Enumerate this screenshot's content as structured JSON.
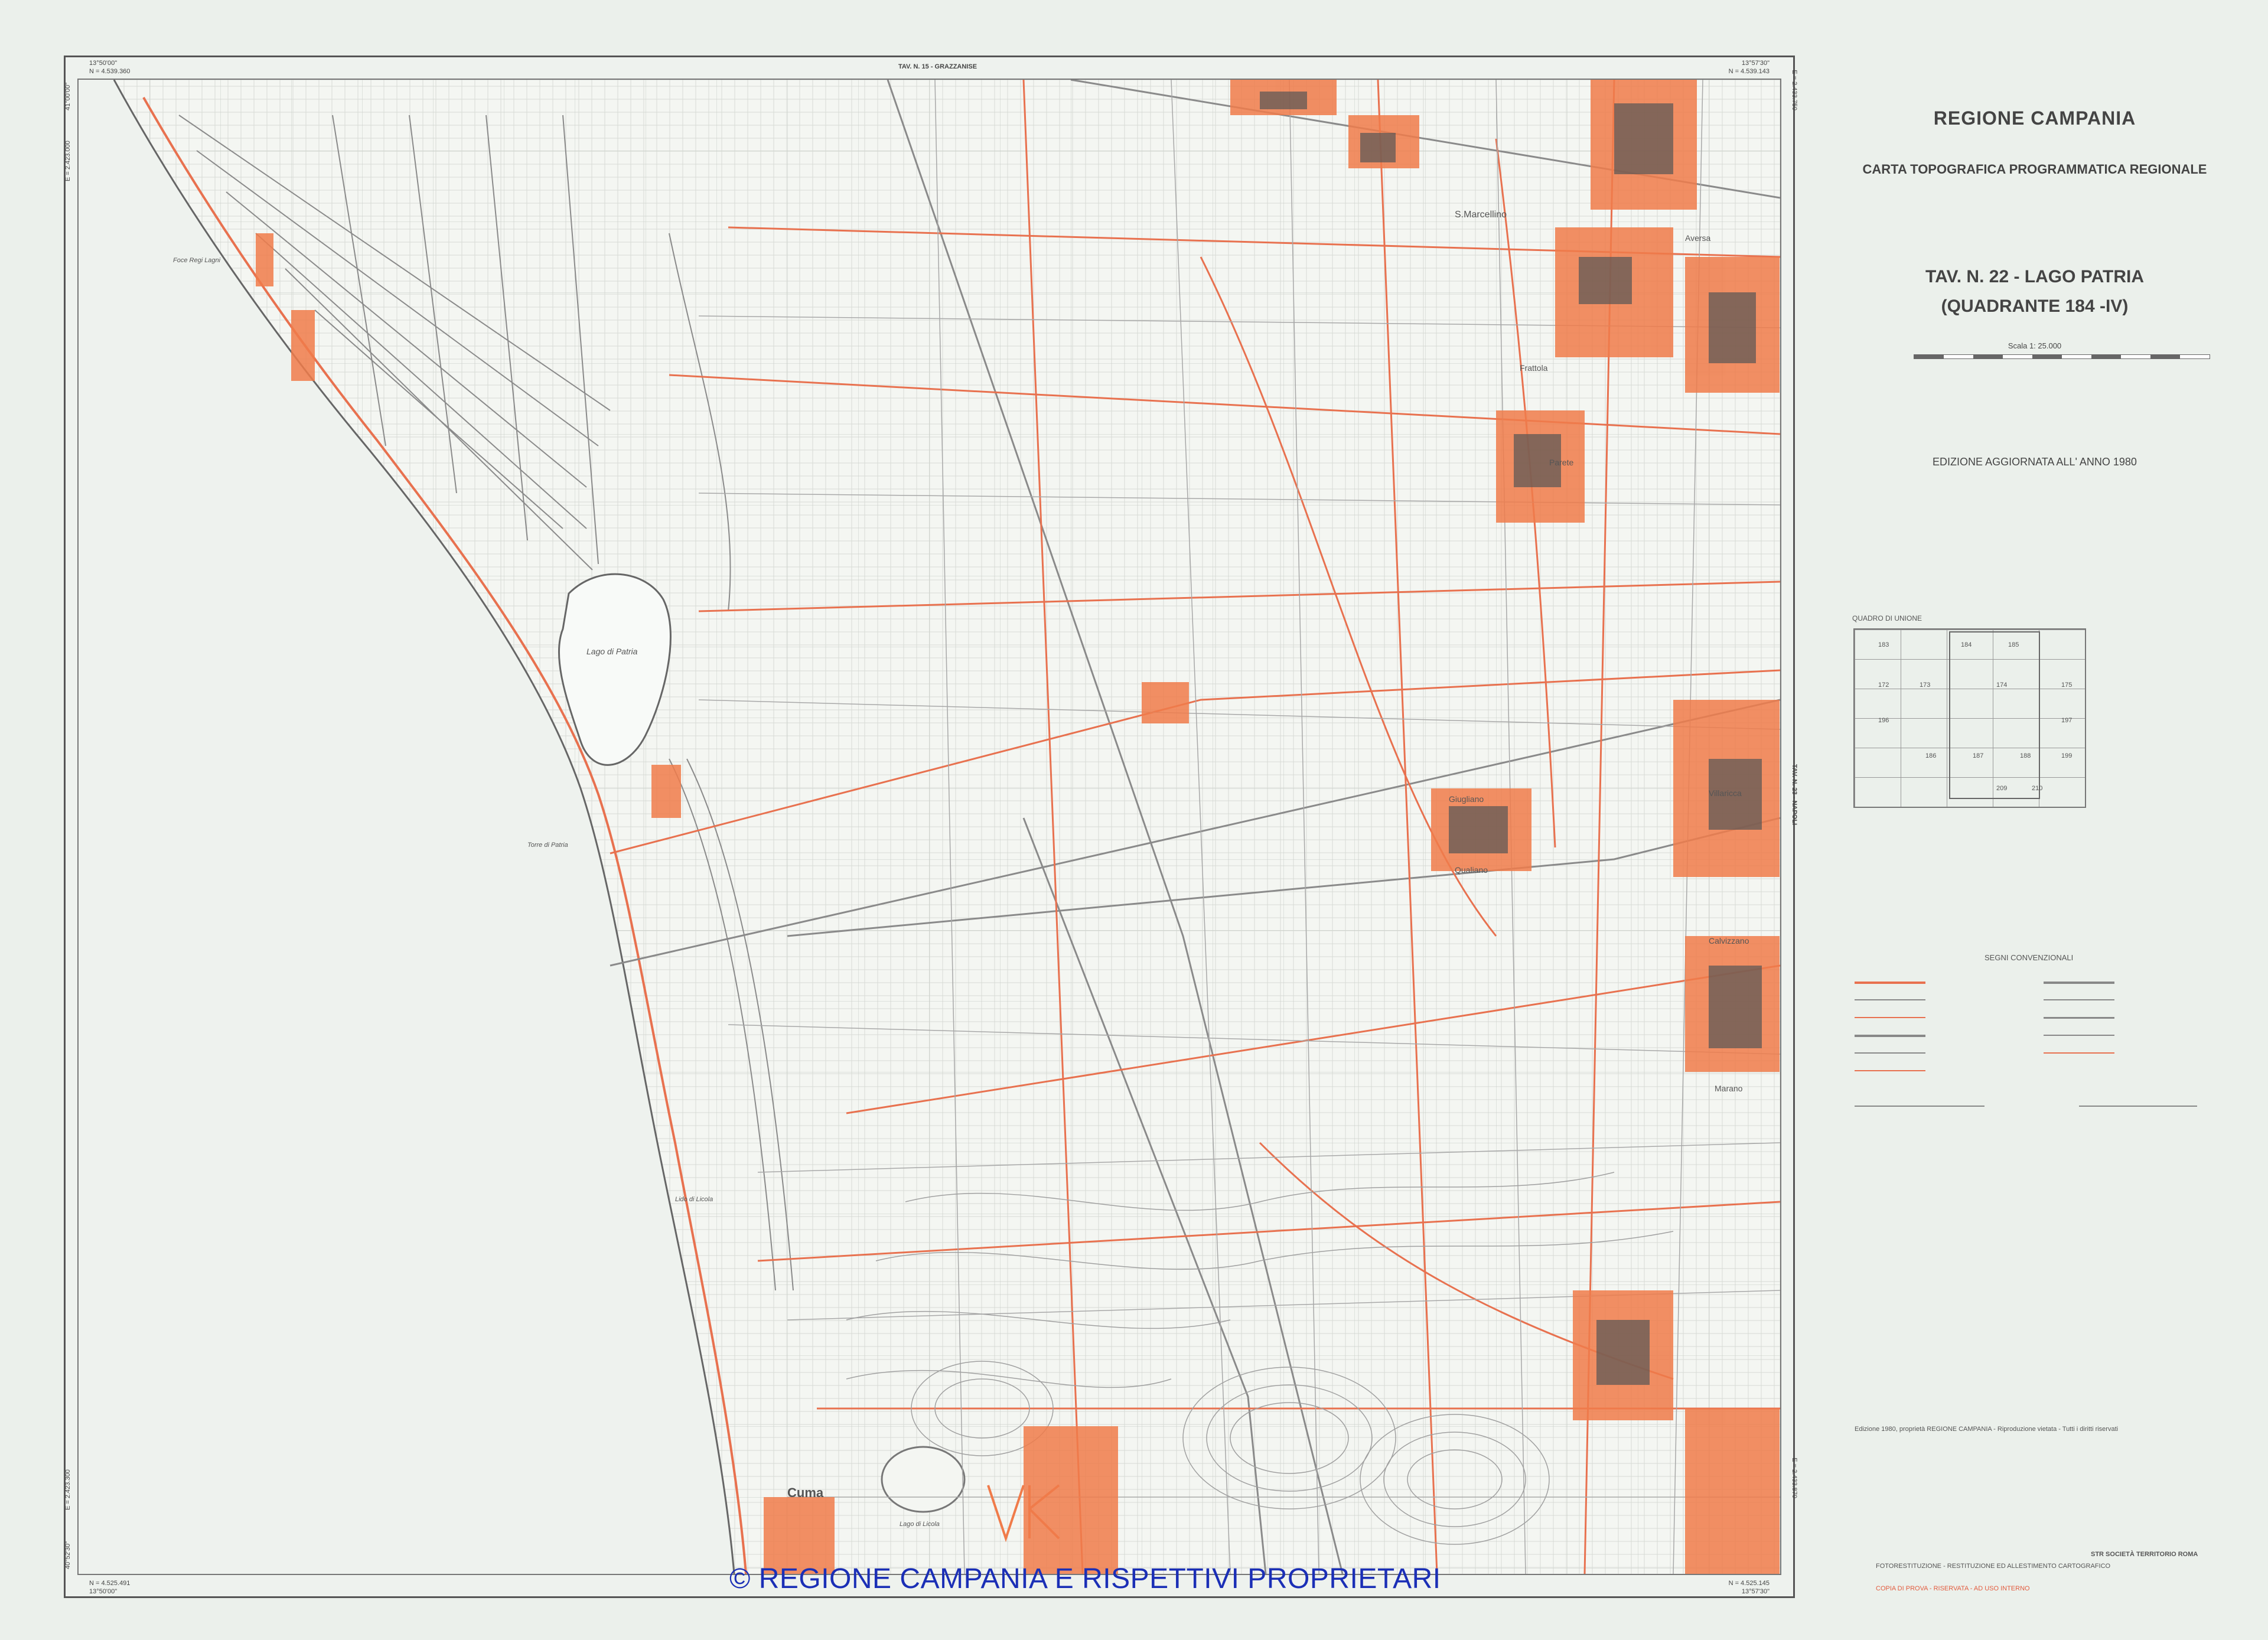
{
  "map": {
    "header_title": "TAV. N. 15 - GRAZZANISE",
    "right_side_label": "TAV. N. 23 - NAPOLI",
    "corner_coords": {
      "top_left_lon": "13°50'00\"",
      "top_left_north": "N = 4.539.360",
      "top_left_lat": "41°00'00\"",
      "top_left_east": "E = 2.423.000",
      "top_right_lon": "13°57'30\"",
      "top_right_north": "N = 4.539.143",
      "top_right_east": "E = 2.433.750",
      "bottom_left_lat": "40°52'30\"",
      "bottom_left_north": "N = 4.525.491",
      "bottom_left_lon": "13°50'00\"",
      "bottom_left_east": "E = 2.423.300",
      "bottom_right_north": "N = 4.525.145",
      "bottom_right_lon": "13°57'30\"",
      "bottom_right_east": "E = 2.433.870"
    },
    "place_labels": [
      "Lago di Patria",
      "S.Marcellino",
      "Frattola",
      "Parete",
      "Giugliano",
      "Aversa",
      "Villaricca",
      "Qualiano",
      "Calvizzano",
      "Marano",
      "Cuma",
      "Lido di Licola",
      "Foce Regi Lagni",
      "Torre di Patria",
      "Lago di Licola"
    ],
    "colors": {
      "roads": "#e8714f",
      "urban": "#f07b4a",
      "contours": "#9a9a9a",
      "grid": "#b5b5b5"
    }
  },
  "panel": {
    "title_region": "REGIONE CAMPANIA",
    "title_series": "CARTA TOPOGRAFICA PROGRAMMATICA REGIONALE",
    "sheet_name": "TAV. N. 22 - LAGO PATRIA",
    "quadrant": "(QUADRANTE 184 -IV)",
    "scale": "Scala 1: 25.000",
    "edition": "EDIZIONE AGGIORNATA ALL' ANNO 1980",
    "index_title": "QUADRO DI UNIONE",
    "legend_title": "SEGNI CONVENZIONALI",
    "index_numbers": [
      "183",
      "184",
      "185",
      "172",
      "173",
      "174",
      "175",
      "196",
      "197",
      "186",
      "187",
      "188",
      "199",
      "209",
      "210"
    ],
    "credit_line1": "Edizione 1980, proprietà REGIONE CAMPANIA - Riproduzione vietata - Tutti i diritti riservati",
    "credit_line2": "FOTORESTITUZIONE - RESTITUZIONE ED ALLESTIMENTO CARTOGRAFICO",
    "credit_line3": "COPIA DI PROVA - RISERVATA - AD USO INTERNO",
    "credit_company": "STR SOCIETÀ TERRITORIO ROMA"
  },
  "watermark": "© REGIONE CAMPANIA E RISPETTIVI PROPRIETARI"
}
